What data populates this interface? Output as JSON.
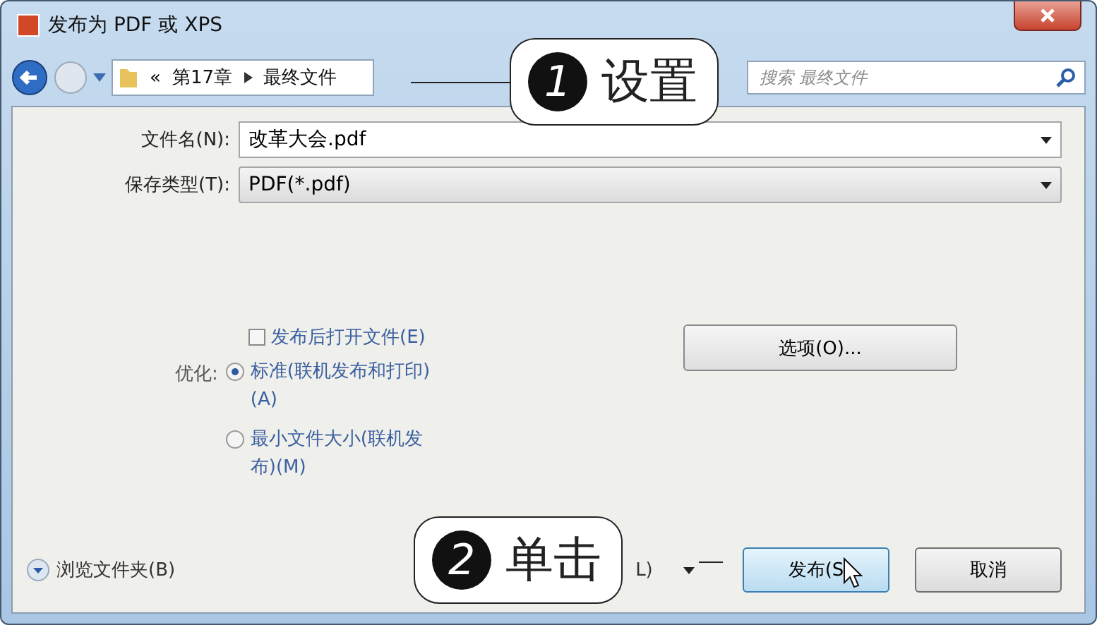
{
  "window": {
    "title": "发布为 PDF 或 XPS"
  },
  "navigation": {
    "overflow": "«",
    "breadcrumb": [
      "第17章",
      "最终文件"
    ],
    "search": {
      "placeholder": "搜索 最终文件"
    }
  },
  "fields": [
    {
      "label": "文件名(N):",
      "value": "改革大会.pdf",
      "kind": "input"
    },
    {
      "label": "保存类型(T):",
      "value": "PDF(*.pdf)",
      "kind": "select"
    }
  ],
  "open_after_publish": {
    "label": "发布后打开文件(E)",
    "checked": false
  },
  "optimize": {
    "label": "优化:",
    "options": [
      {
        "label": "标准(联机发布和打印)(A)",
        "selected": true
      },
      {
        "label": "最小文件大小(联机发布)(M)",
        "selected": false
      }
    ]
  },
  "options_button": "选项(O)...",
  "browse_folders": "浏览文件夹(B)",
  "tools_button": "L)",
  "buttons": [
    {
      "label": "发布(S",
      "kind": "primary"
    },
    {
      "label": "取消",
      "kind": "normal"
    }
  ],
  "callouts": [
    {
      "number": "1",
      "text": "设置"
    },
    {
      "number": "2",
      "text": "单击"
    }
  ]
}
